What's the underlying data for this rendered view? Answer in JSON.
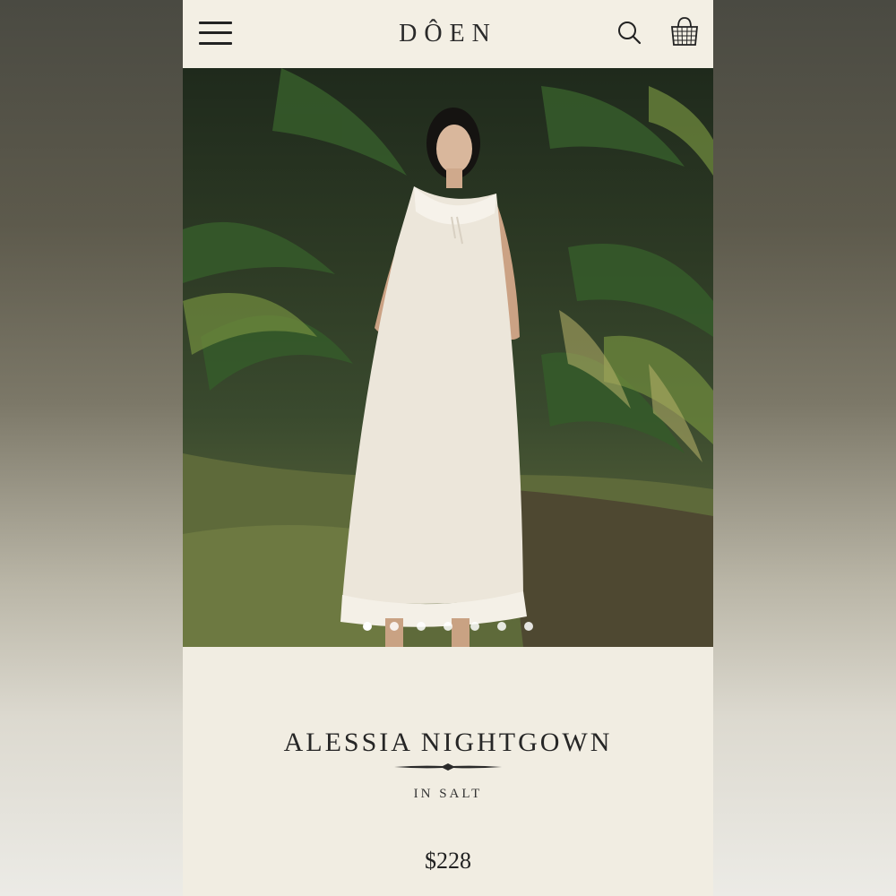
{
  "header": {
    "logo": "DÔEN",
    "icons": {
      "menu": "hamburger-menu-icon",
      "search": "search-icon",
      "bag": "basket-bag-icon"
    }
  },
  "hero": {
    "image_description_icon": "product-photo",
    "carousel": {
      "total": 7,
      "active_index": 0
    }
  },
  "product": {
    "name": "ALESSIA NIGHTGOWN",
    "variant": "IN SALT",
    "price": "$228"
  },
  "colors": {
    "background": "#f1ede2",
    "text": "#262626",
    "dot": "#ffffff"
  }
}
